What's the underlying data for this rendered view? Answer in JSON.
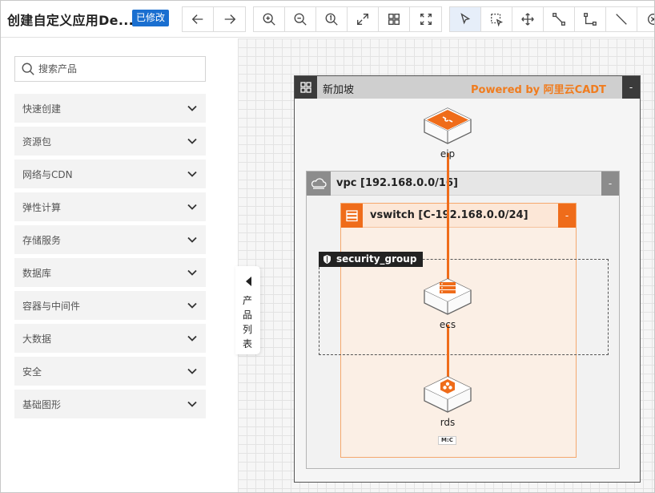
{
  "app": {
    "title": "创建自定义应用De...",
    "status_badge": "已修改"
  },
  "toolbar": {
    "groups": [
      [
        {
          "name": "undo",
          "icon": "undo-arrow-icon"
        },
        {
          "name": "redo",
          "icon": "redo-arrow-icon"
        }
      ],
      [
        {
          "name": "zoom-in",
          "icon": "zoom-in-icon"
        },
        {
          "name": "zoom-out",
          "icon": "zoom-out-icon"
        },
        {
          "name": "actual-size",
          "icon": "actual-size-icon"
        },
        {
          "name": "fit",
          "icon": "expand-diagonal-icon"
        },
        {
          "name": "layout",
          "icon": "grid-layout-icon"
        },
        {
          "name": "fullscreen",
          "icon": "fullscreen-icon"
        }
      ],
      [
        {
          "name": "select",
          "icon": "pointer-icon",
          "active": true
        },
        {
          "name": "box-select",
          "icon": "box-select-icon"
        },
        {
          "name": "pan",
          "icon": "move-icon"
        },
        {
          "name": "connect",
          "icon": "connector-icon"
        },
        {
          "name": "elbow",
          "icon": "elbow-line-icon"
        },
        {
          "name": "line",
          "icon": "line-icon"
        },
        {
          "name": "close",
          "icon": "close-circle-icon"
        }
      ]
    ]
  },
  "sidebar": {
    "search_placeholder": "搜索产品",
    "categories": [
      "快速创建",
      "资源包",
      "网络与CDN",
      "弹性计算",
      "存储服务",
      "数据库",
      "容器与中间件",
      "大数据",
      "安全",
      "基础图形"
    ],
    "collapse_label": "产品列表"
  },
  "diagram": {
    "region": {
      "name": "新加坡",
      "brand": "Powered by 阿里云CADT",
      "collapse": "-"
    },
    "vpc": {
      "name": "vpc [192.168.0.0/16]",
      "collapse": "-"
    },
    "vswitch": {
      "name": "vswitch [C-192.168.0.0/24]",
      "collapse": "-"
    },
    "security_group": {
      "name": "security_group"
    },
    "nodes": {
      "eip": {
        "label": "eip"
      },
      "ecs": {
        "label": "ecs"
      },
      "rds": {
        "label": "rds",
        "tag": "M:C"
      }
    },
    "accent_color": "#ef6c1a"
  }
}
